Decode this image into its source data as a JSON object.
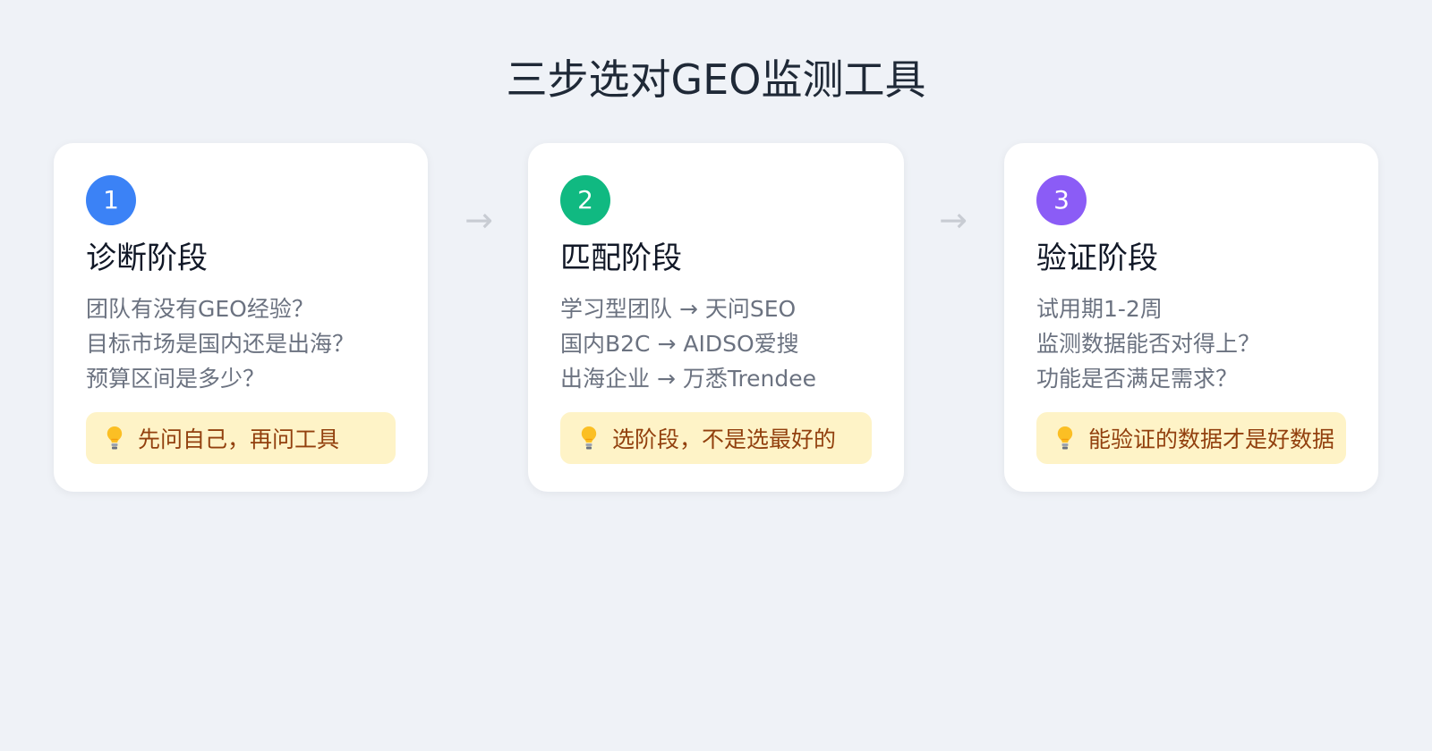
{
  "page": {
    "title": "三步选对GEO监测工具"
  },
  "arrows": [
    "→",
    "→"
  ],
  "steps": [
    {
      "number": "1",
      "title": "诊断阶段",
      "lines": [
        "团队有没有GEO经验？",
        "目标市场是国内还是出海？",
        "预算区间是多少？"
      ],
      "tip": "先问自己，再问工具",
      "accent_color": "#3b82f6",
      "tip_icon": "lightbulb-icon"
    },
    {
      "number": "2",
      "title": "匹配阶段",
      "lines": [
        "学习型团队 → 天问SEO",
        "国内B2C → AIDSO爱搜",
        "出海企业 → 万悉Trendee"
      ],
      "tip": "选阶段，不是选最好的",
      "accent_color": "#10b981",
      "tip_icon": "lightbulb-icon"
    },
    {
      "number": "3",
      "title": "验证阶段",
      "lines": [
        "试用期1-2周",
        "监测数据能否对得上？",
        "功能是否满足需求？"
      ],
      "tip": "能验证的数据才是好数据",
      "accent_color": "#8b5cf6",
      "tip_icon": "lightbulb-icon"
    }
  ],
  "colors": {
    "background": "#eff2f7",
    "card": "#ffffff",
    "tip_background": "#fef3c7",
    "tip_text": "#92400e",
    "body_text": "#6b7280",
    "title_text": "#111827",
    "arrow": "#c8ccd3"
  }
}
